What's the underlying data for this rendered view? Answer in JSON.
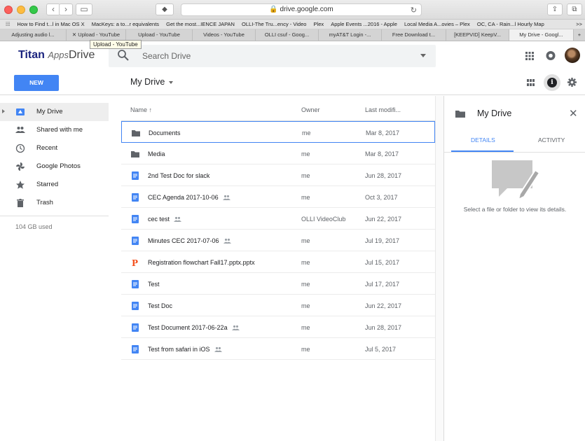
{
  "browser": {
    "url": "drive.google.com",
    "bookmarks": [
      "How to Find t...l in Mac OS X",
      "MacKeys: a to...r equivalents",
      "Get the most...IENCE JAPAN",
      "OLLI-The Tru...ency - Video",
      "Plex",
      "Apple Events ...2016 - Apple",
      "Local Media A...ovies – Plex",
      "OC, CA - Rain...l Hourly Map"
    ],
    "tabs": [
      "Adjusting audio l...",
      "Upload - YouTube",
      "Upload - YouTube",
      "Videos - YouTube",
      "OLLI csuf - Goog...",
      "myAT&T Login -...",
      "Free Download t...",
      "[KEEPVID] KeepV...",
      "My Drive - Googl..."
    ],
    "tooltip": "Upload - YouTube",
    "bookmarks_more": ">>",
    "tab_plus": "+"
  },
  "header": {
    "logo_titan": "Titan",
    "logo_apps": "Apps",
    "product": "Drive",
    "search_placeholder": "Search Drive"
  },
  "toolbar": {
    "new_label": "NEW",
    "breadcrumb": "My Drive"
  },
  "sidebar": {
    "items": [
      {
        "label": "My Drive",
        "icon": "drive-icon"
      },
      {
        "label": "Shared with me",
        "icon": "people-icon"
      },
      {
        "label": "Recent",
        "icon": "clock-icon"
      },
      {
        "label": "Google Photos",
        "icon": "pinwheel-icon"
      },
      {
        "label": "Starred",
        "icon": "star-icon"
      },
      {
        "label": "Trash",
        "icon": "trash-icon"
      }
    ],
    "storage": "104 GB used"
  },
  "list": {
    "columns": {
      "name": "Name",
      "owner": "Owner",
      "modified": "Last modifi..."
    },
    "rows": [
      {
        "name": "Documents",
        "type": "folder",
        "shared": false,
        "owner": "me",
        "modified": "Mar 8, 2017"
      },
      {
        "name": "Media",
        "type": "folder",
        "shared": false,
        "owner": "me",
        "modified": "Mar 8, 2017"
      },
      {
        "name": "2nd Test Doc for slack",
        "type": "doc",
        "shared": false,
        "owner": "me",
        "modified": "Jun 28, 2017"
      },
      {
        "name": "CEC Agenda 2017-10-06",
        "type": "doc",
        "shared": true,
        "owner": "me",
        "modified": "Oct 3, 2017"
      },
      {
        "name": "cec test",
        "type": "doc",
        "shared": true,
        "owner": "OLLI VideoClub",
        "modified": "Jun 22, 2017"
      },
      {
        "name": "Minutes CEC 2017-07-06",
        "type": "doc",
        "shared": true,
        "owner": "me",
        "modified": "Jul 19, 2017"
      },
      {
        "name": "Registration flowchart Fall17.pptx.pptx",
        "type": "pptx",
        "shared": false,
        "owner": "me",
        "modified": "Jul 15, 2017"
      },
      {
        "name": "Test",
        "type": "doc",
        "shared": false,
        "owner": "me",
        "modified": "Jul 17, 2017"
      },
      {
        "name": "Test Doc",
        "type": "doc",
        "shared": false,
        "owner": "me",
        "modified": "Jun 22, 2017"
      },
      {
        "name": "Test Document 2017-06-22a",
        "type": "doc",
        "shared": true,
        "owner": "me",
        "modified": "Jun 28, 2017"
      },
      {
        "name": "Test from safari in iOS",
        "type": "doc",
        "shared": true,
        "owner": "me",
        "modified": "Jul 5, 2017"
      }
    ]
  },
  "details": {
    "title": "My Drive",
    "tab_details": "DETAILS",
    "tab_activity": "ACTIVITY",
    "message": "Select a file or folder to view its details."
  },
  "colors": {
    "accent": "#4285f4",
    "doc": "#4285f4",
    "pptx": "#f4511e",
    "folder": "#5f6368"
  }
}
